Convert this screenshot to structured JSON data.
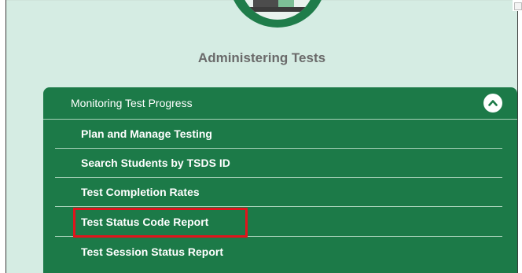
{
  "section": {
    "title": "Administering Tests"
  },
  "accordion": {
    "header_label": "Monitoring Test Progress",
    "collapse_icon": "chevron-up-icon",
    "items": [
      {
        "label": "Plan and Manage Testing"
      },
      {
        "label": "Search Students by TSDS ID"
      },
      {
        "label": "Test Completion Rates"
      },
      {
        "label": "Test Status Code Report",
        "highlighted": true
      },
      {
        "label": "Test Session Status Report"
      }
    ]
  },
  "colors": {
    "panel_background": "#d5ece3",
    "accordion_green": "#1c7a48",
    "highlight_red": "#e0141c",
    "title_gray": "#6a6a6a"
  }
}
